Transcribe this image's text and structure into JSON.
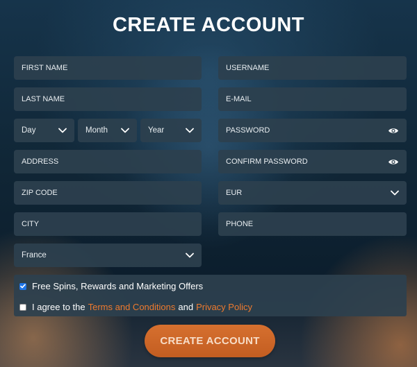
{
  "title": "CREATE ACCOUNT",
  "left_fields": {
    "first_name": "FIRST NAME",
    "last_name": "LAST NAME",
    "day": "Day",
    "month": "Month",
    "year": "Year",
    "address": "ADDRESS",
    "zip_code": "ZIP CODE",
    "city": "CITY",
    "country": "France"
  },
  "right_fields": {
    "username": "USERNAME",
    "email": "E-MAIL",
    "password": "PASSWORD",
    "confirm_password": "CONFIRM PASSWORD",
    "currency": "EUR",
    "phone": "PHONE"
  },
  "checks": {
    "marketing": {
      "label": "Free Spins, Rewards and Marketing Offers",
      "checked": true
    },
    "terms": {
      "prefix": "I agree to the",
      "terms_link": "Terms and Conditions",
      "middle": "and",
      "privacy_link": "Privacy Policy",
      "checked": false
    }
  },
  "submit_label": "CREATE ACCOUNT",
  "colors": {
    "accent": "#ee7a2e",
    "button": "#cc6427",
    "field_bg": "#2c404e",
    "checkbox": "#1e74e6"
  },
  "icons": {
    "select": "chevron-down-icon",
    "password": "eye-icon",
    "checked": "check-icon"
  }
}
